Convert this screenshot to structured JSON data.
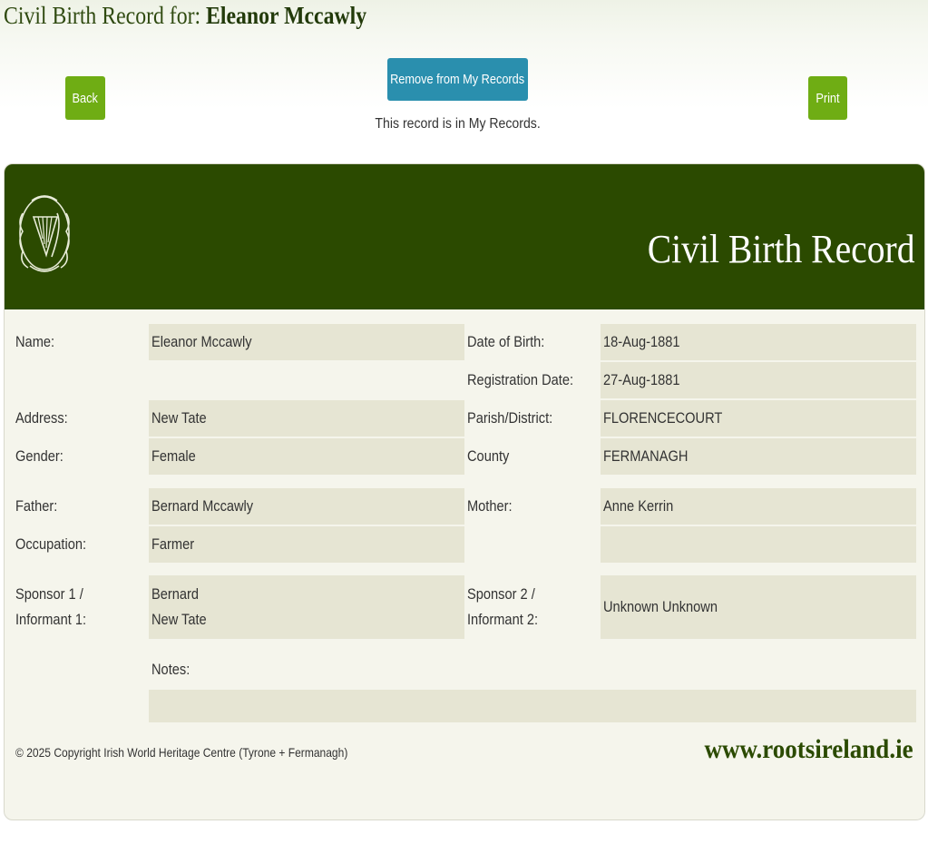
{
  "page": {
    "title_prefix": "Civil Birth Record for: ",
    "title_name": "Eleanor Mccawly"
  },
  "actions": {
    "back_label": "Back",
    "remove_label": "Remove from My Records",
    "print_label": "Print",
    "status_text": "This record is in My Records."
  },
  "card": {
    "header_title": "Civil Birth Record",
    "logo_icon": "harp-emblem-icon",
    "colors": {
      "header": "#2b4a00",
      "button_green": "#6fad14",
      "button_blue": "#2a8fae"
    }
  },
  "record": {
    "name_label": "Name:",
    "name": "Eleanor Mccawly",
    "dob_label": "Date of Birth:",
    "dob": "18-Aug-1881",
    "reg_label": "Registration Date:",
    "reg_date": "27-Aug-1881",
    "address_label": "Address:",
    "address": "New Tate",
    "parish_label": "Parish/District:",
    "parish": "FLORENCECOURT",
    "gender_label": "Gender:",
    "gender": "Female",
    "county_label": "County",
    "county": "FERMANAGH",
    "father_label": "Father:",
    "father": "Bernard Mccawly",
    "mother_label": "Mother:",
    "mother": "Anne Kerrin",
    "occupation_label": "Occupation:",
    "occupation": "Farmer",
    "sponsor1_label_1": "Sponsor 1 /",
    "sponsor1_label_2": "Informant 1:",
    "sponsor1_line1": "Bernard",
    "sponsor1_line2": "New Tate",
    "sponsor2_label_1": "Sponsor 2 /",
    "sponsor2_label_2": "Informant 2:",
    "sponsor2": "Unknown Unknown",
    "notes_label": "Notes:",
    "notes": ""
  },
  "footer": {
    "copyright": "© 2025 Copyright Irish World Heritage Centre (Tyrone + Fermanagh)",
    "website": "www.rootsireland.ie"
  }
}
